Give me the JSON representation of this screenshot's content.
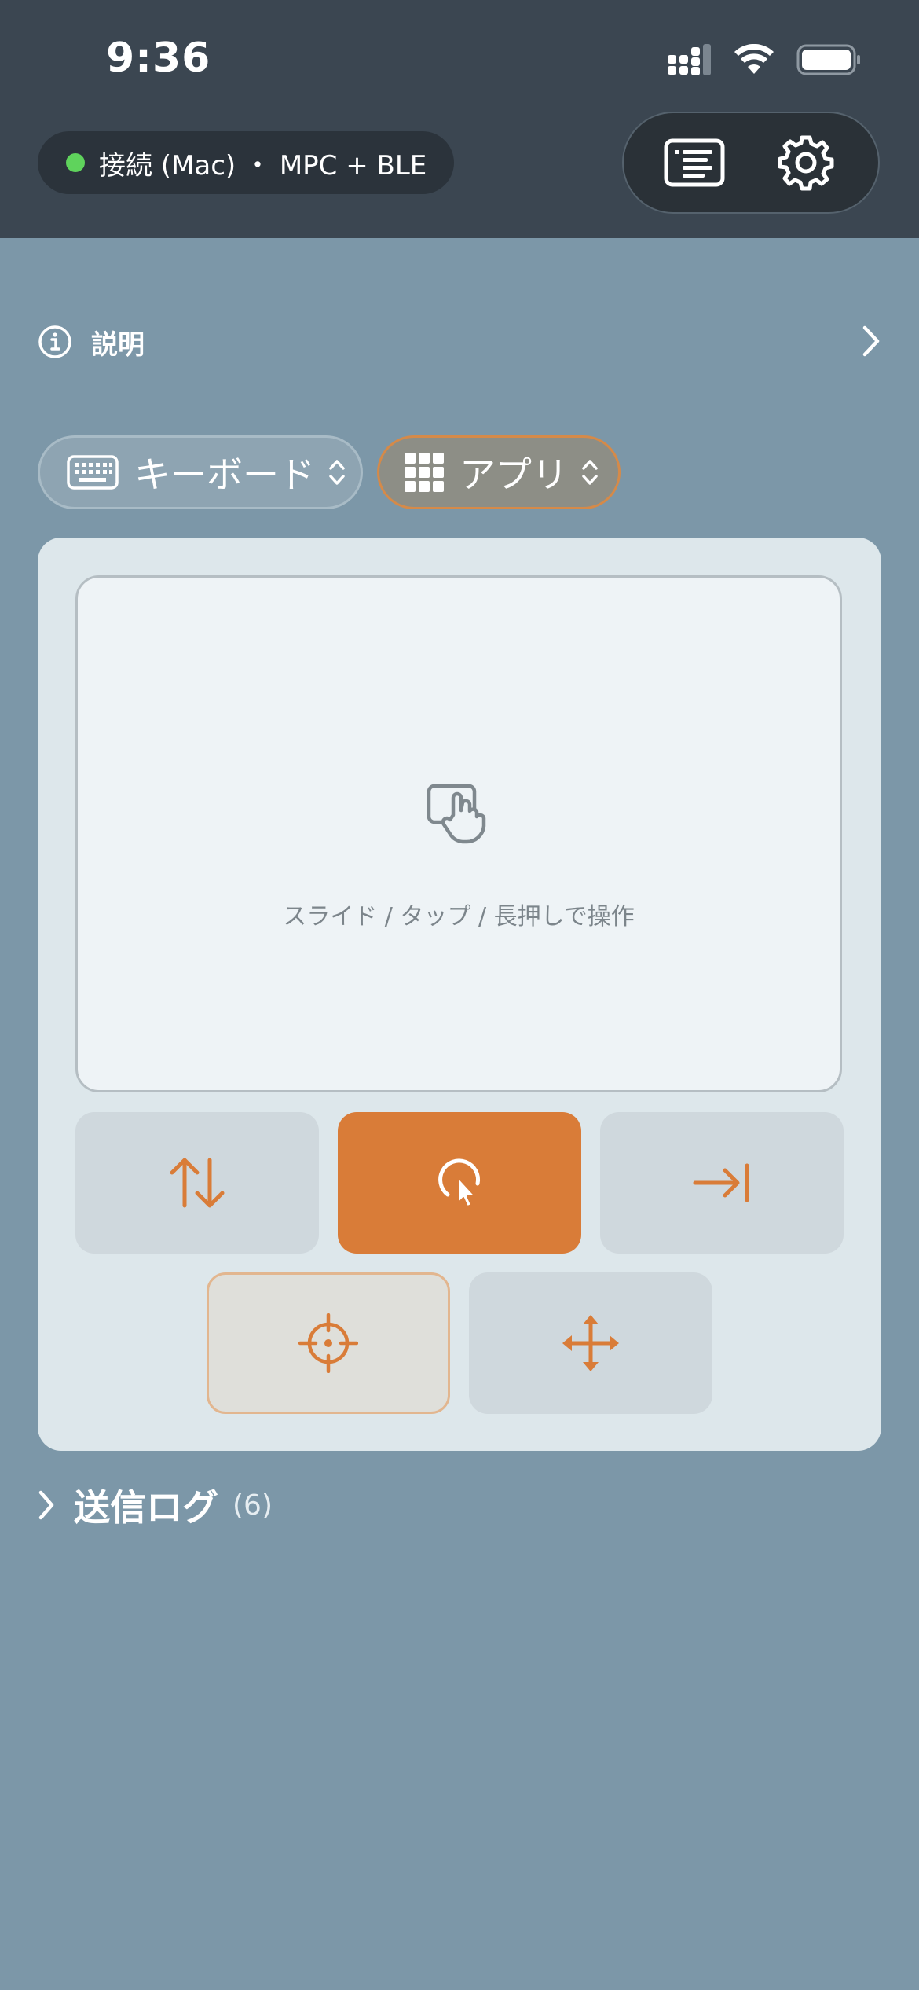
{
  "status_bar": {
    "time": "9:36",
    "signal_icon": "cellular-signal-icon",
    "wifi_icon": "wifi-icon",
    "battery_icon": "battery-icon"
  },
  "connection": {
    "label": "接続 (Mac) ・ MPC + BLE",
    "status_color": "#5fd35c"
  },
  "toolbar": {
    "log_icon": "list-panel-icon",
    "settings_icon": "gear-icon"
  },
  "info": {
    "label": "説明"
  },
  "mode_chips": {
    "keyboard_label": "キーボード",
    "app_label": "アプリ"
  },
  "trackpad": {
    "hint": "スライド / タップ / 長押しで操作",
    "icon": "touch-gesture-icon"
  },
  "mode_buttons": [
    {
      "icon": "scroll-arrows-icon",
      "state": "normal"
    },
    {
      "icon": "click-cursor-icon",
      "state": "active"
    },
    {
      "icon": "tab-arrow-icon",
      "state": "normal"
    },
    {
      "icon": "crosshair-icon",
      "state": "outlined"
    },
    {
      "icon": "move-arrows-icon",
      "state": "normal"
    }
  ],
  "log": {
    "title": "送信ログ",
    "count": "(6)"
  },
  "colors": {
    "accent": "#d97c38",
    "header_bg": "#3b4651",
    "page_bg": "#7c97a8"
  }
}
